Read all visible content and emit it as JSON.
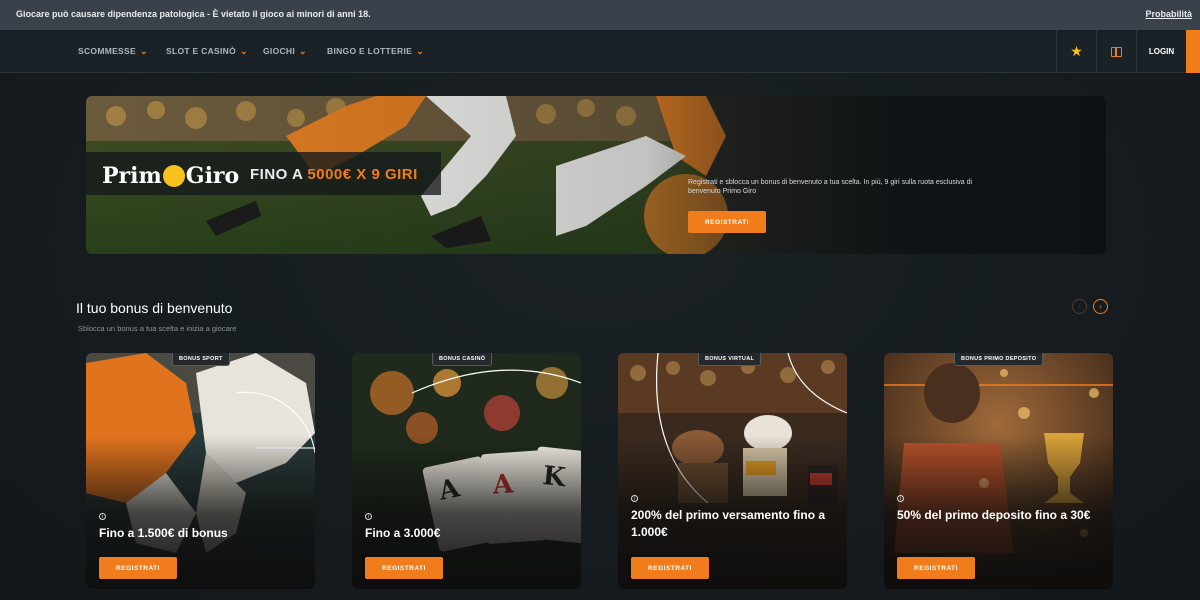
{
  "topbar": {
    "message": "Giocare può causare dipendenza patologica - È vietato il gioco ai minori di anni 18.",
    "link": "Probabilità"
  },
  "nav": {
    "items": [
      {
        "label": "SCOMMESSE"
      },
      {
        "label": "SLOT E CASINÒ"
      },
      {
        "label": "GIOCHI"
      },
      {
        "label": "BINGO E LOTTERIE"
      }
    ],
    "login": "LOGIN",
    "icons": [
      "star-icon",
      "gift-icon"
    ]
  },
  "hero": {
    "logo_part1": "Prim",
    "logo_part2": "Giro",
    "headline_prefix": "FINO A ",
    "headline_highlight": "5000€ X 9 GIRI",
    "description": "Registrati e sblocca un bonus di benvenuto a tua scelta. In più, 9 giri sulla ruota esclusiva di benvenuto Primo Giro",
    "button": "REGISTRATI"
  },
  "welcome": {
    "title": "Il tuo bonus di benvenuto",
    "subtitle": "Sblocca un bonus a tua scelta e inizia a giocare"
  },
  "cards": [
    {
      "tag": "BONUS SPORT",
      "title": "Fino a 1.500€ di bonus",
      "button": "REGISTRATI"
    },
    {
      "tag": "BONUS CASINÒ",
      "title": "Fino a 3.000€",
      "button": "REGISTRATI"
    },
    {
      "tag": "BONUS VIRTUAL",
      "title": "200% del primo versamento fino a 1.000€",
      "button": "REGISTRATI"
    },
    {
      "tag": "BONUS PRIMO DEPOSITO",
      "title": "50% del primo deposito fino a 30€",
      "button": "REGISTRATI"
    }
  ],
  "card_art": {
    "card_ranks": [
      "A",
      "A",
      "K"
    ]
  },
  "colors": {
    "accent": "#f07c1c",
    "star": "#f6c21b",
    "topbar": "#39424b",
    "navbar": "#1b2227"
  }
}
